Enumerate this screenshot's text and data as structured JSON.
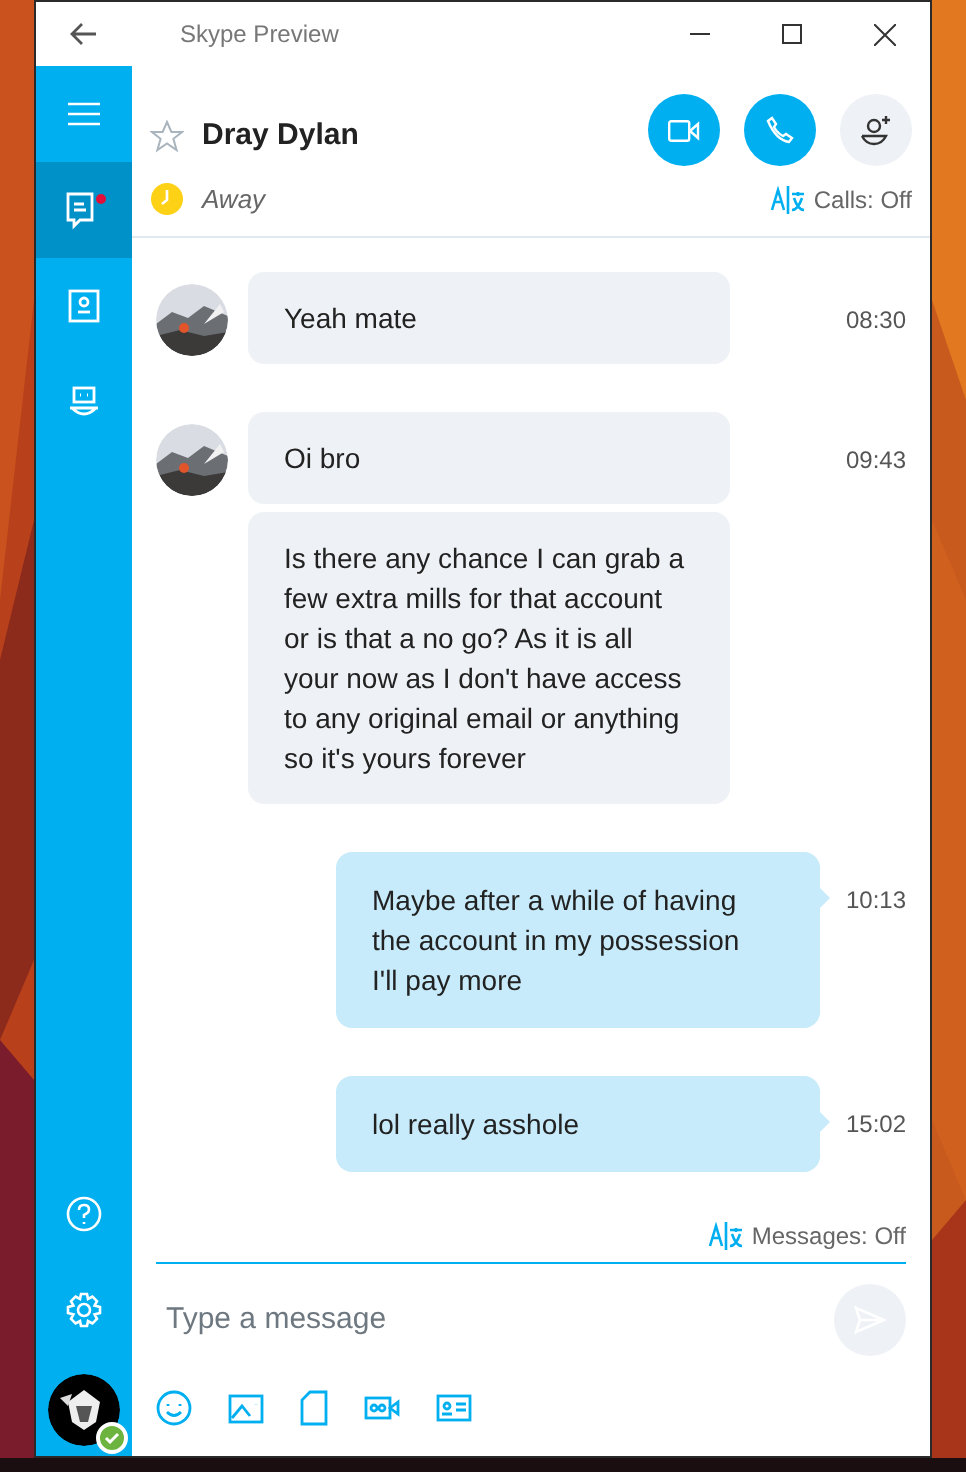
{
  "window": {
    "title": "Skype Preview"
  },
  "sidebar": {
    "items": [
      {
        "kind": "chats",
        "selected": true,
        "unread": true
      },
      {
        "kind": "contacts",
        "selected": false,
        "unread": false
      },
      {
        "kind": "bots",
        "selected": false,
        "unread": false
      }
    ],
    "user": {
      "online": true
    }
  },
  "contact": {
    "name": "Dray Dylan",
    "status": "Away",
    "favorite": false
  },
  "calls_translation": "Calls: Off",
  "messages": [
    {
      "kind": "incoming",
      "avatar": true,
      "text": "Yeah mate",
      "time": "08:30"
    },
    {
      "kind": "incoming",
      "avatar": true,
      "text": "Oi bro",
      "time": "09:43"
    },
    {
      "kind": "incoming",
      "avatar": false,
      "text": "Is there any chance I can grab a few extra mills for that account or is that a no go? As it is all your now as I don't have access to any original email or anything so it's yours forever"
    },
    {
      "kind": "outgoing",
      "text": "Maybe after a while of having the account in my possession I'll pay more",
      "time": "10:13"
    },
    {
      "kind": "outgoing",
      "text": "lol really asshole",
      "time": "15:02"
    }
  ],
  "messages_translation": "Messages: Off",
  "composer": {
    "placeholder": "Type a message"
  }
}
